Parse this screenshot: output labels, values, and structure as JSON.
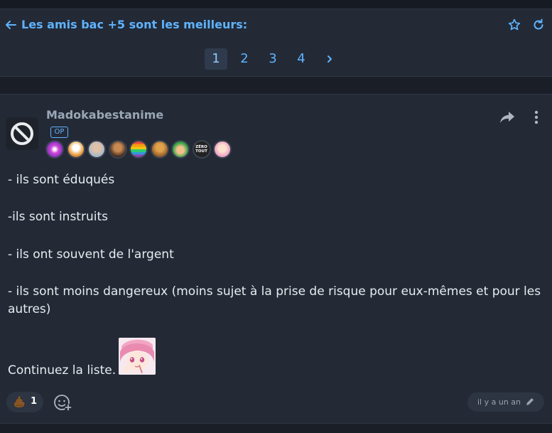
{
  "header": {
    "title": "Les amis bac +5 sont les meilleurs:",
    "back_icon": "arrow-left-icon",
    "star_icon": "star-icon",
    "refresh_icon": "refresh-icon"
  },
  "pagination": {
    "pages": [
      "1",
      "2",
      "3",
      "4"
    ],
    "current": "1",
    "next_label": "›"
  },
  "post": {
    "author": "Madokabestanime",
    "op_label": "OP",
    "avatar_icon": "banned-icon",
    "badges": [
      "badge-1",
      "badge-2",
      "badge-3",
      "badge-4",
      "badge-5",
      "badge-6",
      "badge-7",
      "badge-8",
      "badge-9"
    ],
    "badge_8_text": "ZÉRO TOUT",
    "lines": [
      "- ils sont éduqués",
      "-ils sont instruits",
      "- ils ont souvent de l'argent",
      "- ils sont moins dangereux (moins sujet à la prise de risque pour eux-mêmes et pour les autres)",
      "Continuez la liste."
    ],
    "reaction_count": "1",
    "timestamp": "il y a un an"
  },
  "colors": {
    "accent": "#5fb3ff",
    "background": "#232a36",
    "text": "#e8ebf0"
  }
}
